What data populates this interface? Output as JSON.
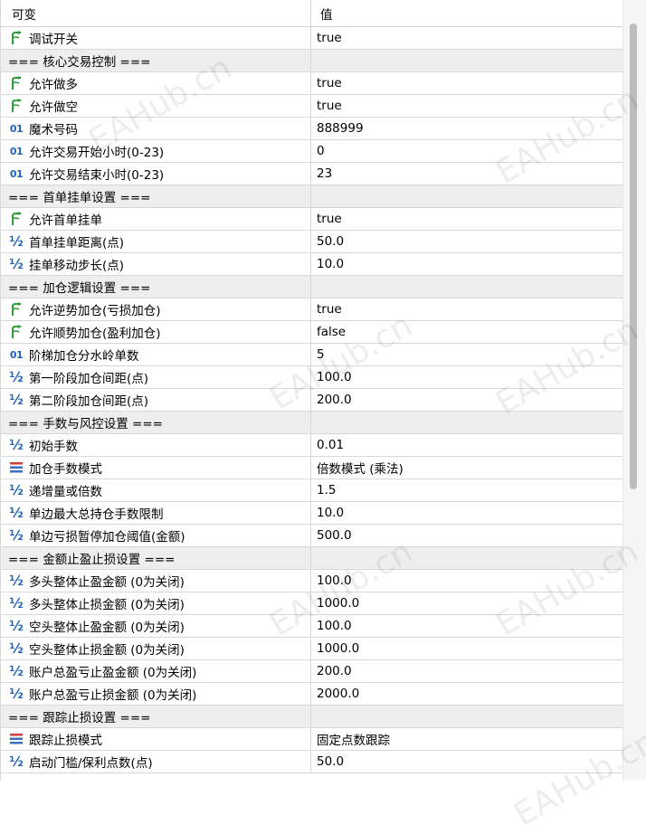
{
  "header": {
    "col_name": "可变",
    "col_value": "值"
  },
  "rows": [
    {
      "type": "bool",
      "name": "调试开关",
      "value": "true"
    },
    {
      "type": "section",
      "name": "=== 核心交易控制 ===",
      "value": ""
    },
    {
      "type": "bool",
      "name": "允许做多",
      "value": "true"
    },
    {
      "type": "bool",
      "name": "允许做空",
      "value": "true"
    },
    {
      "type": "int",
      "name": "魔术号码",
      "value": "888999"
    },
    {
      "type": "int",
      "name": "允许交易开始小时(0-23)",
      "value": "0"
    },
    {
      "type": "int",
      "name": "允许交易结束小时(0-23)",
      "value": "23"
    },
    {
      "type": "section",
      "name": "=== 首单挂单设置 ===",
      "value": ""
    },
    {
      "type": "bool",
      "name": "允许首单挂单",
      "value": "true"
    },
    {
      "type": "double",
      "name": "首单挂单距离(点)",
      "value": "50.0"
    },
    {
      "type": "double",
      "name": "挂单移动步长(点)",
      "value": "10.0"
    },
    {
      "type": "section",
      "name": "=== 加仓逻辑设置 ===",
      "value": ""
    },
    {
      "type": "bool",
      "name": "允许逆势加仓(亏损加仓)",
      "value": "true"
    },
    {
      "type": "bool",
      "name": "允许顺势加仓(盈利加仓)",
      "value": "false"
    },
    {
      "type": "int",
      "name": "阶梯加仓分水岭单数",
      "value": "5"
    },
    {
      "type": "double",
      "name": "第一阶段加仓间距(点)",
      "value": "100.0"
    },
    {
      "type": "double",
      "name": "第二阶段加仓间距(点)",
      "value": "200.0"
    },
    {
      "type": "section",
      "name": "=== 手数与风控设置 ===",
      "value": ""
    },
    {
      "type": "double",
      "name": "初始手数",
      "value": "0.01"
    },
    {
      "type": "enum",
      "name": "加仓手数模式",
      "value": "倍数模式 (乘法)"
    },
    {
      "type": "double",
      "name": "递增量或倍数",
      "value": "1.5"
    },
    {
      "type": "double",
      "name": "单边最大总持仓手数限制",
      "value": "10.0"
    },
    {
      "type": "double",
      "name": "单边亏损暂停加仓阈值(金额)",
      "value": "500.0"
    },
    {
      "type": "section",
      "name": "=== 金额止盈止损设置 ===",
      "value": ""
    },
    {
      "type": "double",
      "name": "多头整体止盈金额 (0为关闭)",
      "value": "100.0"
    },
    {
      "type": "double",
      "name": "多头整体止损金额 (0为关闭)",
      "value": "1000.0"
    },
    {
      "type": "double",
      "name": "空头整体止盈金额 (0为关闭)",
      "value": "100.0"
    },
    {
      "type": "double",
      "name": "空头整体止损金额 (0为关闭)",
      "value": "1000.0"
    },
    {
      "type": "double",
      "name": "账户总盈亏止盈金额 (0为关闭)",
      "value": "200.0"
    },
    {
      "type": "double",
      "name": "账户总盈亏止损金额 (0为关闭)",
      "value": "2000.0"
    },
    {
      "type": "section",
      "name": "=== 跟踪止损设置 ===",
      "value": ""
    },
    {
      "type": "enum",
      "name": "跟踪止损模式",
      "value": "固定点数跟踪"
    },
    {
      "type": "double",
      "name": "启动门槛/保利点数(点)",
      "value": "50.0"
    }
  ],
  "icons": {
    "bool": "green-flag-arrow-icon",
    "int": "integer-01-icon",
    "double": "fraction-half-icon",
    "enum": "enum-list-icon"
  },
  "watermark": "EAHub.cn",
  "colors": {
    "bool_icon": "#2f9e3a",
    "num_icon": "#1f63b8",
    "enum_icon_a": "#d23c3c",
    "enum_icon_b": "#3a6fc4",
    "section_bg": "#eeeeee"
  }
}
